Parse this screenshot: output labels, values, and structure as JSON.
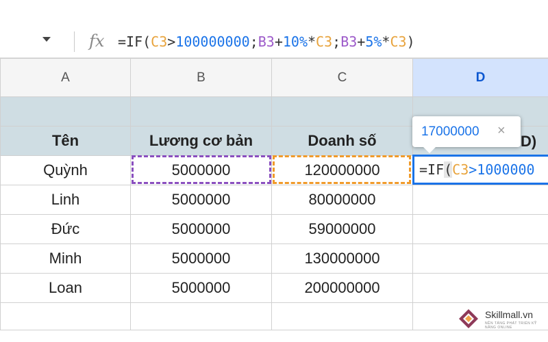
{
  "formula_bar": {
    "fx_label": "fx",
    "tokens": [
      {
        "text": "=IF(",
        "color": "#333333"
      },
      {
        "text": "C3",
        "color": "#e8a33c"
      },
      {
        "text": ">",
        "color": "#333333"
      },
      {
        "text": "100000000",
        "color": "#1a73e8"
      },
      {
        "text": ";",
        "color": "#333333"
      },
      {
        "text": "B3",
        "color": "#9c59c9"
      },
      {
        "text": "+",
        "color": "#333333"
      },
      {
        "text": "10%",
        "color": "#1a73e8"
      },
      {
        "text": "*",
        "color": "#333333"
      },
      {
        "text": "C3",
        "color": "#e8a33c"
      },
      {
        "text": ";",
        "color": "#333333"
      },
      {
        "text": "B3",
        "color": "#9c59c9"
      },
      {
        "text": "+",
        "color": "#333333"
      },
      {
        "text": "5%",
        "color": "#1a73e8"
      },
      {
        "text": "*",
        "color": "#333333"
      },
      {
        "text": "C3",
        "color": "#e8a33c"
      },
      {
        "text": ")",
        "color": "#333333"
      }
    ]
  },
  "columns": [
    "A",
    "B",
    "C",
    "D"
  ],
  "header": {
    "name": "Tên",
    "salary": "Lương cơ bản",
    "sales": "Doanh số",
    "d_partial": "D)"
  },
  "rows": [
    {
      "name": "Quỳnh",
      "salary": "5000000",
      "sales": "120000000"
    },
    {
      "name": "Linh",
      "salary": "5000000",
      "sales": "80000000"
    },
    {
      "name": "Đức",
      "salary": "5000000",
      "sales": "59000000"
    },
    {
      "name": "Minh",
      "salary": "5000000",
      "sales": "130000000"
    },
    {
      "name": "Loan",
      "salary": "5000000",
      "sales": "200000000"
    }
  ],
  "edit_cell": {
    "tokens": [
      {
        "text": "=IF",
        "color": "#333333"
      },
      {
        "text": "(",
        "color": "#333333",
        "hl": true
      },
      {
        "text": "C3",
        "color": "#e8a33c"
      },
      {
        "text": ">1000000",
        "color": "#1a73e8"
      }
    ]
  },
  "tooltip": {
    "value": "17000000",
    "close": "×"
  },
  "logo": {
    "text": "Skillmall.vn",
    "sub": "NỀN TẢNG PHÁT TRIỂN KỸ NĂNG ONLINE"
  },
  "colors": {
    "selected_col": "#d3e3fd",
    "header_fill": "#cfdde3",
    "ref_b3": "#8a4fbf",
    "ref_c3": "#f09a2a",
    "active_border": "#1a73e8"
  }
}
